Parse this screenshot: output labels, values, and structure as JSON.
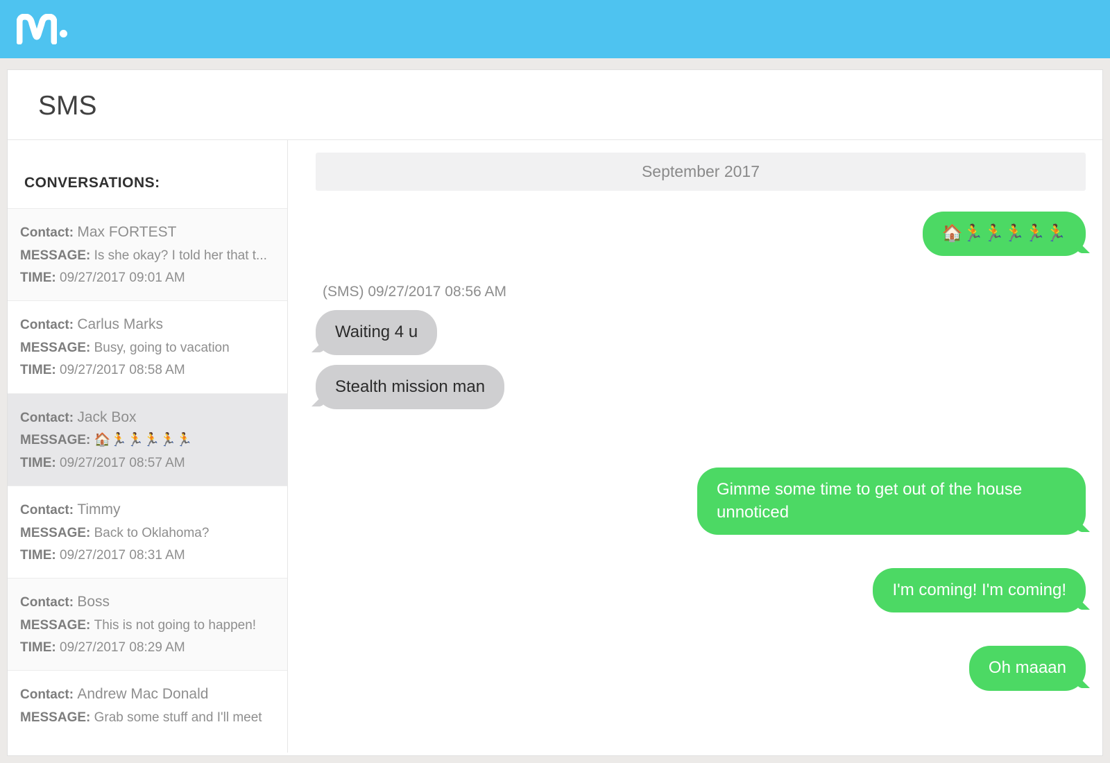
{
  "header": {
    "brand": "m"
  },
  "page": {
    "title": "SMS"
  },
  "sidebar": {
    "heading": "CONVERSATIONS:",
    "labels": {
      "contact": "Contact:",
      "message": "MESSAGE:",
      "time": "TIME:"
    },
    "items": [
      {
        "contact": "Max FORTEST",
        "message": "Is she okay? I told her that t...",
        "time": "09/27/2017 09:01 AM",
        "selected": false,
        "alt": false
      },
      {
        "contact": "Carlus Marks",
        "message": "Busy, going to vacation",
        "time": "09/27/2017 08:58 AM",
        "selected": false,
        "alt": true
      },
      {
        "contact": "Jack Box",
        "message": "🏠🏃🏃🏃🏃🏃",
        "time": "09/27/2017 08:57 AM",
        "selected": true,
        "alt": false
      },
      {
        "contact": "Timmy",
        "message": "Back to Oklahoma?",
        "time": "09/27/2017 08:31 AM",
        "selected": false,
        "alt": true
      },
      {
        "contact": "Boss",
        "message": "This is not going to happen!",
        "time": "09/27/2017 08:29 AM",
        "selected": false,
        "alt": false
      },
      {
        "contact": "Andrew Mac Donald",
        "message": "Grab some stuff and I'll meet",
        "time": "",
        "selected": false,
        "alt": true
      }
    ]
  },
  "thread": {
    "month": "September 2017",
    "incoming_meta": "(SMS) 09/27/2017 08:56 AM",
    "messages": [
      {
        "dir": "out",
        "text": "🏠🏃🏃🏃🏃🏃"
      },
      {
        "dir": "in",
        "text": "Waiting 4 u"
      },
      {
        "dir": "in",
        "text": "Stealth mission man"
      },
      {
        "dir": "out",
        "text": "Gimme some time to get out of the house unnoticed"
      },
      {
        "dir": "out",
        "text": "I'm coming! I'm coming!"
      },
      {
        "dir": "out",
        "text": "Oh maaan"
      }
    ]
  }
}
